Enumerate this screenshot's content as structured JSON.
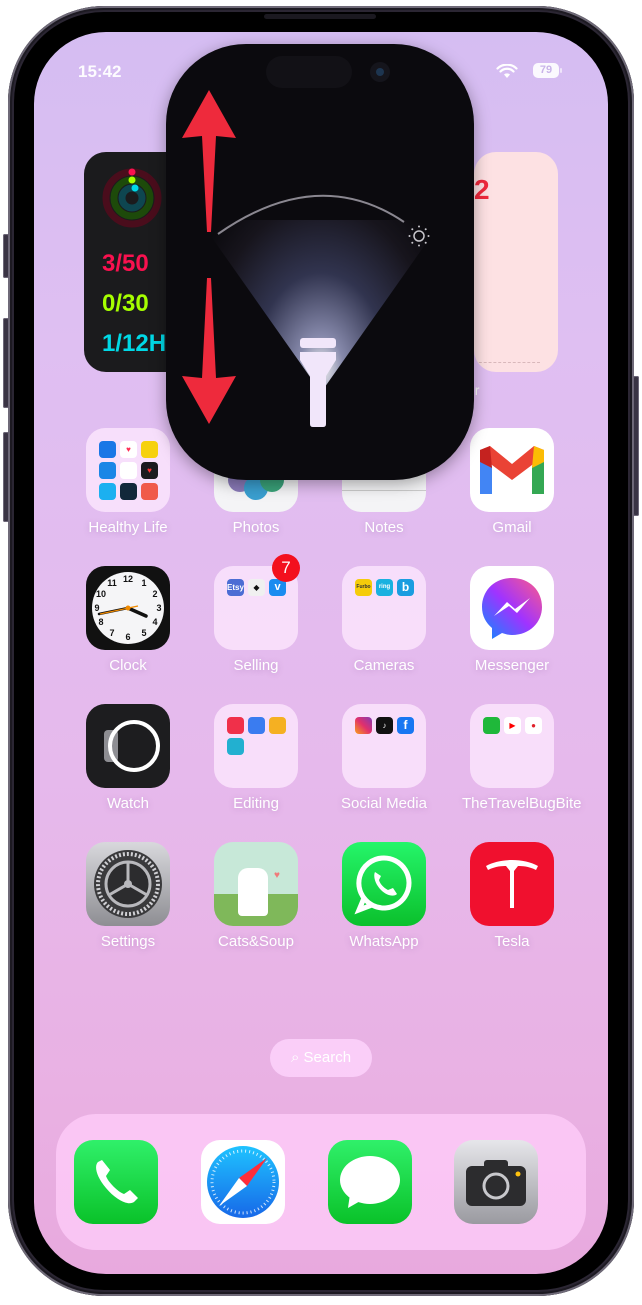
{
  "status_bar": {
    "time": "15:42",
    "wifi_icon": "wifi-icon",
    "battery": "79"
  },
  "widgets": {
    "fitness": {
      "move": "3/50",
      "exercise": "0/30",
      "stand": "1/12H",
      "colors": {
        "move": "#fa114f",
        "exercise": "#a6ff00",
        "stand": "#00d9e6"
      }
    },
    "calendar": {
      "number": "2",
      "label": "er"
    }
  },
  "flashlight_overlay": {
    "icon": "flashlight-icon",
    "brightness_icon": "sun-icon",
    "annotation": "red double-headed arrow (swipe up/down)",
    "accent_color": "#ee2a3c"
  },
  "apps": [
    {
      "label": "Healthy Life",
      "type": "folder"
    },
    {
      "label": "Photos",
      "type": "app"
    },
    {
      "label": "Notes",
      "type": "app"
    },
    {
      "label": "Gmail",
      "type": "app"
    },
    {
      "label": "Clock",
      "type": "app"
    },
    {
      "label": "Selling",
      "type": "folder",
      "badge": "7"
    },
    {
      "label": "Cameras",
      "type": "folder"
    },
    {
      "label": "Messenger",
      "type": "app"
    },
    {
      "label": "Watch",
      "type": "app"
    },
    {
      "label": "Editing",
      "type": "folder"
    },
    {
      "label": "Social Media",
      "type": "folder"
    },
    {
      "label": "TheTravelBugBite",
      "type": "folder"
    },
    {
      "label": "Settings",
      "type": "app"
    },
    {
      "label": "Cats&Soup",
      "type": "app"
    },
    {
      "label": "WhatsApp",
      "type": "app"
    },
    {
      "label": "Tesla",
      "type": "app"
    }
  ],
  "folder_minis": {
    "selling": [
      "Etsy",
      "",
      "v"
    ],
    "cameras": [
      "Furbo",
      "ring",
      "b"
    ]
  },
  "search": {
    "label": "Search"
  },
  "dock": [
    {
      "name": "Phone"
    },
    {
      "name": "Safari"
    },
    {
      "name": "Messages"
    },
    {
      "name": "Camera"
    }
  ]
}
